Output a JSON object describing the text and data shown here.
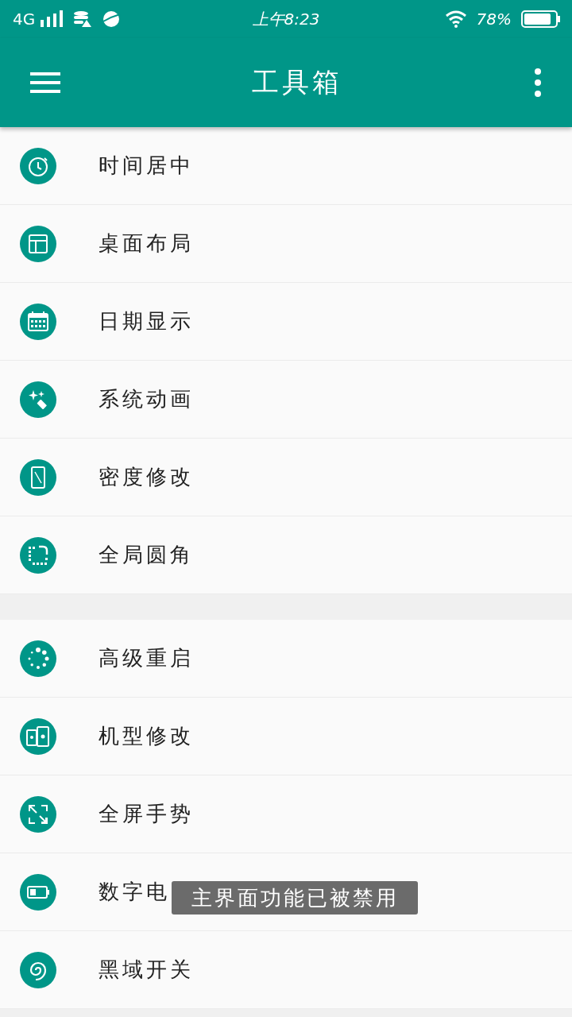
{
  "status_bar": {
    "network": "4G",
    "time": "上午8:23",
    "battery": "78%"
  },
  "app_bar": {
    "title": "工具箱"
  },
  "groups": [
    {
      "items": [
        {
          "label": "时间居中"
        },
        {
          "label": "桌面布局"
        },
        {
          "label": "日期显示"
        },
        {
          "label": "系统动画"
        },
        {
          "label": "密度修改"
        },
        {
          "label": "全局圆角"
        }
      ]
    },
    {
      "items": [
        {
          "label": "高级重启"
        },
        {
          "label": "机型修改"
        },
        {
          "label": "全屏手势"
        },
        {
          "label": "数字电"
        },
        {
          "label": "黑域开关"
        }
      ]
    }
  ],
  "toast": {
    "text": "主界面功能已被禁用"
  }
}
